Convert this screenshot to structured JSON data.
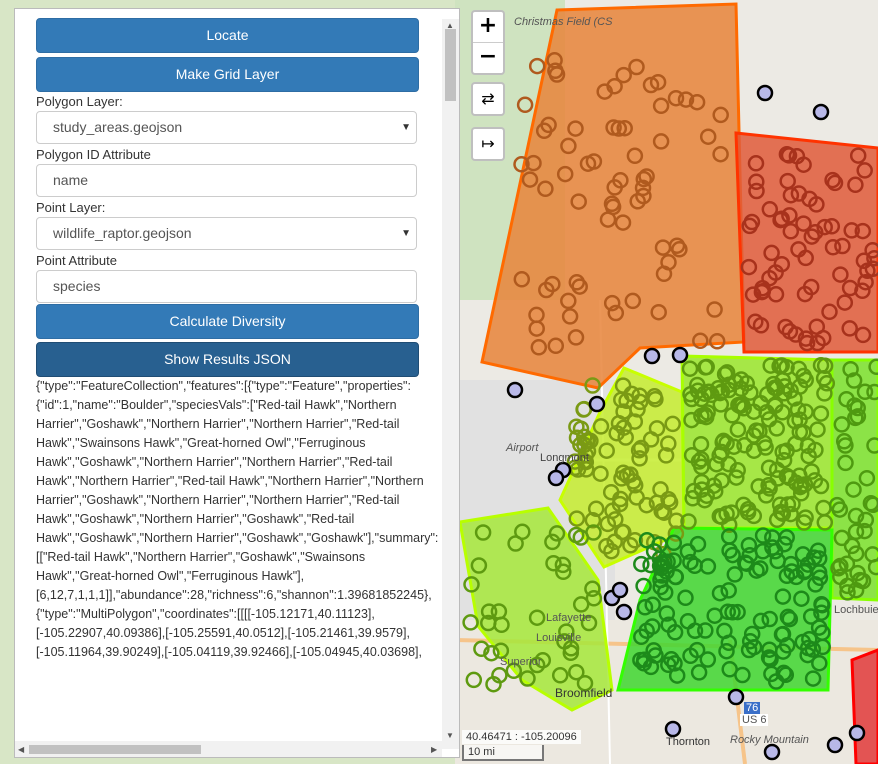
{
  "panel": {
    "locate_button": "Locate",
    "grid_button": "Make Grid Layer",
    "polygon_layer_label": "Polygon Layer:",
    "polygon_layer_value": "study_areas.geojson",
    "polygon_id_label": "Polygon ID Attribute",
    "polygon_id_value": "name",
    "point_layer_label": "Point Layer:",
    "point_layer_value": "wildlife_raptor.geojson",
    "point_attr_label": "Point Attribute",
    "point_attr_value": "species",
    "calculate_button": "Calculate Diversity",
    "results_button": "Show Results JSON",
    "results_json": "{\"type\":\"FeatureCollection\",\"features\":[{\"type\":\"Feature\",\"properties\":{\"id\":1,\"name\":\"Boulder\",\"speciesVals\":[\"Red-tail Hawk\",\"Northern Harrier\",\"Goshawk\",\"Northern Harrier\",\"Northern Harrier\",\"Red-tail Hawk\",\"Swainsons Hawk\",\"Great-horned Owl\",\"Ferruginous Hawk\",\"Goshawk\",\"Northern Harrier\",\"Northern Harrier\",\"Red-tail Hawk\",\"Northern Harrier\",\"Red-tail Hawk\",\"Northern Harrier\",\"Northern Harrier\",\"Goshawk\",\"Northern Harrier\",\"Northern Harrier\",\"Red-tail Hawk\",\"Goshawk\",\"Northern Harrier\",\"Goshawk\",\"Red-tail Hawk\",\"Goshawk\",\"Northern Harrier\",\"Goshawk\",\"Goshawk\"],\"summary\":[[\"Red-tail Hawk\",\"Northern Harrier\",\"Goshawk\",\"Swainsons Hawk\",\"Great-horned Owl\",\"Ferruginous Hawk\"],[6,12,7,1,1,1]],\"abundance\":28,\"richness\":6,\"shannon\":1.39681852245},{\"type\":\"MultiPolygon\",\"coordinates\":[[[[-105.12171,40.11123],[-105.22907,40.09386],[-105.25591,40.0512],[-105.21461,39.9579],[-105.11964,39.90249],[-105.04119,39.92466],[-105.04945,40.03698],"
  },
  "map": {
    "zoom_in": "+",
    "zoom_out": "−",
    "swap_icon_glyph": "⇄",
    "arrow_icon_glyph": "↦",
    "coordinates": "40.46471 : -105.20096",
    "scale": "10 mi",
    "labels": {
      "christmas_field": "Christmas Field (CS",
      "airport": "Airport",
      "longmont": "Longmont",
      "louisville": "Louisville",
      "superior": "Superior",
      "broomfield": "Broomfield",
      "thornton": "Thornton",
      "rocky_mountain": "Rocky Mountain",
      "us6": "US 6",
      "i76": "76",
      "lochbuie": "Lochbuie",
      "lafayette": "Lafayette"
    }
  },
  "colors": {
    "button": "#337ab7",
    "orange": "#e8843a",
    "red": "#e05a3a",
    "yellowgreen": "#c6ec2f",
    "lightgreen": "#9ae62c",
    "green": "#3fd62f",
    "midgreen": "#68d92c"
  }
}
